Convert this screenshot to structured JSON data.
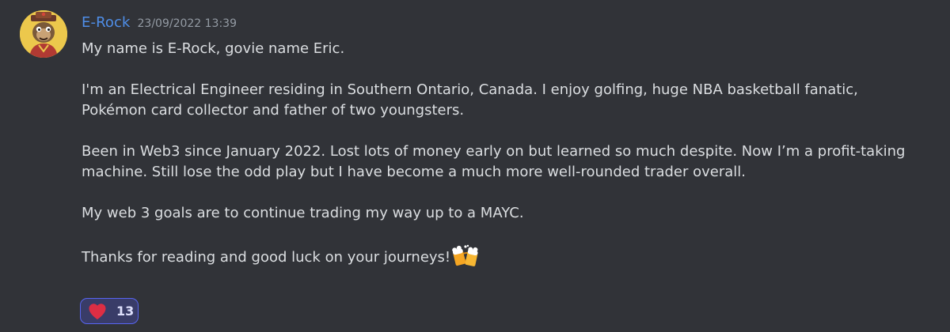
{
  "message": {
    "author": "E-Rock",
    "timestamp": "23/09/2022 13:39",
    "avatar_icon": "ape-avatar-icon",
    "author_color": "#4f8ee8",
    "paragraphs": [
      [
        "My name is E-Rock, govie name Eric."
      ],
      [
        "I'm an Electrical Engineer residing in Southern Ontario, Canada. I enjoy golfing, huge NBA basketball fanatic,",
        "Pokémon card collector and father of two youngsters."
      ],
      [
        "Been in Web3 since January 2022. Lost lots of money early on but learned so much despite. Now I’m a profit-taking",
        "machine. Still lose the odd play but I have become a much more well-rounded trader overall."
      ],
      [
        "My web 3 goals are to continue trading my way up to a MAYC."
      ],
      [
        "Thanks for reading and good luck on your journeys!"
      ]
    ],
    "trailing_emoji": "beer-mugs-icon"
  },
  "reaction": {
    "emoji": "heart-icon",
    "count": "13",
    "accent": "#5865f2"
  }
}
